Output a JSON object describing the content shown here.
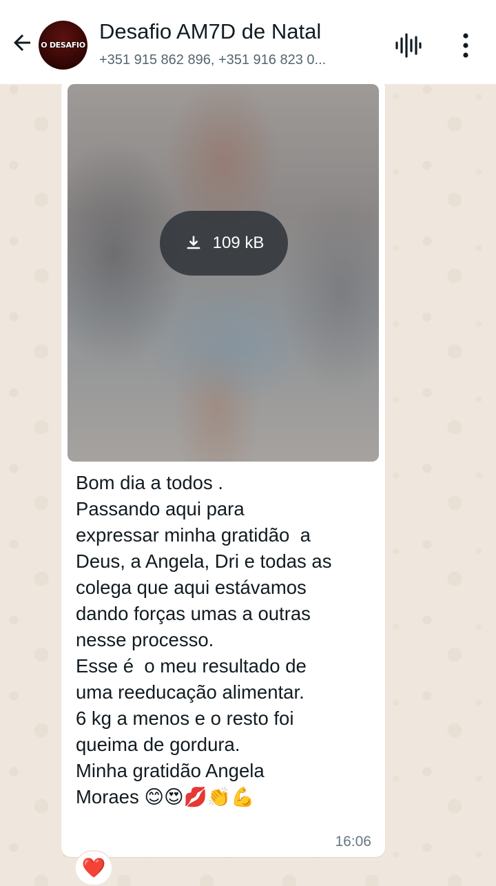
{
  "header": {
    "group_name": "Desafio AM7D de Natal",
    "participants": "+351 915 862 896, +351 916 823 0...",
    "avatar_text": "O DESAFIO",
    "back_icon": "arrow-left-icon",
    "voice_icon": "voice-call-waveform-icon",
    "menu_icon": "more-vertical-icon"
  },
  "message": {
    "media": {
      "download_icon": "download-icon",
      "size_label": "109 kB"
    },
    "text_lines": [
      "Bom dia a todos .",
      "Passando aqui para",
      "expressar minha gratidão  a",
      "Deus, a Angela, Dri e todas as",
      "colega que aqui estávamos",
      "dando forças umas a outras",
      "nesse processo.",
      "Esse é  o meu resultado de",
      "uma reeducação alimentar.",
      "6 kg a menos e o resto foi",
      "queima de gordura.",
      "Minha gratidão Angela",
      "Moraes"
    ],
    "emojis": "😊😍💋👏💪",
    "time": "16:06",
    "reaction": "❤️"
  },
  "colors": {
    "header_bg": "#ffffff",
    "chat_bg": "#efe7dd",
    "bubble_bg": "#ffffff",
    "text": "#111b21",
    "secondary_text": "#54656f",
    "heart": "#e8203b"
  }
}
